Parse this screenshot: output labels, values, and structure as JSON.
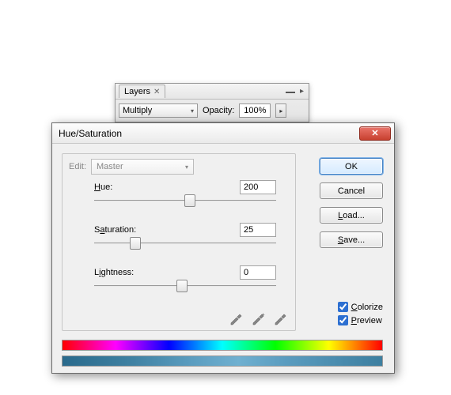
{
  "layers_panel": {
    "tab_title": "Layers",
    "blend_mode": "Multiply",
    "opacity_label": "Opacity:",
    "opacity_value": "100%"
  },
  "dialog": {
    "title": "Hue/Saturation",
    "edit_label": "Edit:",
    "edit_value": "Master",
    "params": {
      "hue": {
        "label": "Hue:",
        "value": "200",
        "pos": 0.53
      },
      "saturation": {
        "label": "Saturation:",
        "value": "25",
        "pos": 0.21
      },
      "lightness": {
        "label": "Lightness:",
        "value": "0",
        "pos": 0.48
      }
    },
    "buttons": {
      "ok": "OK",
      "cancel": "Cancel",
      "load": "Load...",
      "save": "Save..."
    },
    "checks": {
      "colorize": "Colorize",
      "preview": "Preview"
    }
  }
}
